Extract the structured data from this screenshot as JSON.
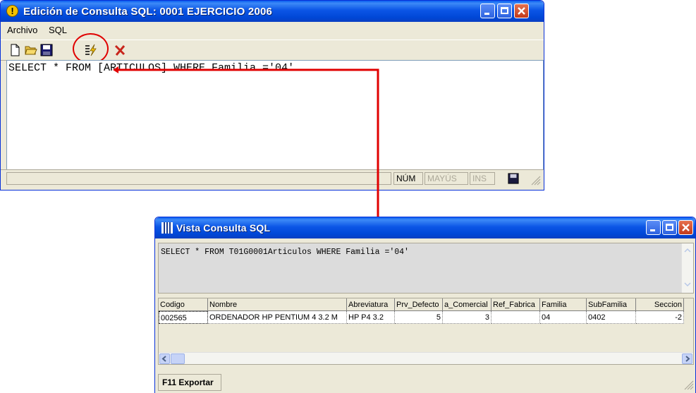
{
  "colors": {
    "titlebar": "#0054e3",
    "callout": "#e00000",
    "window_bg": "#ece9d8"
  },
  "editor_window": {
    "title": "Edición de Consulta SQL: 0001 EJERCICIO 2006",
    "title_icon": "exclamation-icon",
    "menu": [
      "Archivo",
      "SQL"
    ],
    "toolbar": [
      "new-file-icon",
      "open-folder-icon",
      "save-disk-icon",
      "execute-query-icon",
      "delete-x-icon"
    ],
    "sql_text": "SELECT * FROM [ARTICULOS] WHERE Familia ='04'",
    "status": {
      "num": "NÚM",
      "mayus": "MAYÚS",
      "ins": "INS"
    }
  },
  "view_window": {
    "title": "Vista Consulta SQL",
    "title_icon": "grid-icon",
    "sql_text": "SELECT * FROM T01G0001Articulos WHERE Familia ='04'",
    "columns": [
      "Codigo",
      "Nombre",
      "Abreviatura",
      "Prv_Defecto",
      "a_Comercial",
      "Ref_Fabrica",
      "Familia",
      "SubFamilia",
      "Seccion"
    ],
    "rows": [
      [
        "002565",
        "ORDENADOR HP PENTIUM 4 3.2 M",
        "HP P4 3.2",
        "5",
        "3",
        "",
        "04",
        "0402",
        "-2"
      ]
    ],
    "export_button": "F11 Exportar"
  }
}
